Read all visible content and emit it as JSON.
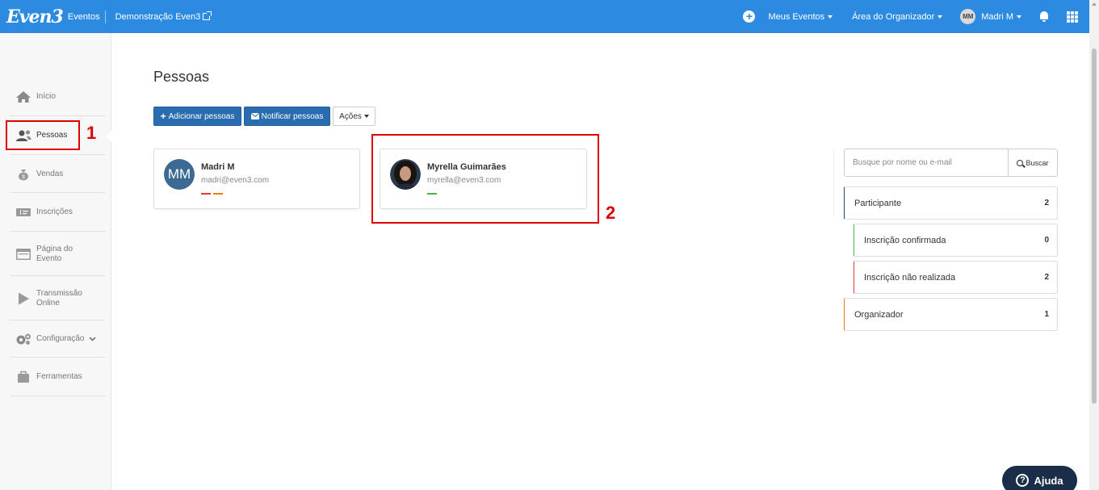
{
  "topbar": {
    "logo": "Even3",
    "events_link": "Eventos",
    "event_name": "Demonstração Even3",
    "my_events": "Meus Eventos",
    "organizer_area": "Área do Organizador",
    "user_initials": "MM",
    "user_name": "Madri M",
    "bg_color": "#2c8be0"
  },
  "sidebar": {
    "items": [
      {
        "label": "Início",
        "icon": "home-icon"
      },
      {
        "label": "Pessoas",
        "icon": "people-icon"
      },
      {
        "label": "Vendas",
        "icon": "money-bag-icon"
      },
      {
        "label": "Inscrições",
        "icon": "ticket-icon"
      },
      {
        "label": "Página do Evento",
        "icon": "browser-icon"
      },
      {
        "label": "Transmissão Online",
        "icon": "play-icon"
      },
      {
        "label": "Configuração",
        "icon": "gears-icon"
      },
      {
        "label": "Ferramentas",
        "icon": "toolbox-icon"
      }
    ]
  },
  "annotations": {
    "one": "1",
    "two": "2"
  },
  "main": {
    "title": "Pessoas",
    "add_button": "Adicionar pessoas",
    "notify_button": "Notificar pessoas",
    "actions_button": "Ações",
    "people": [
      {
        "initials": "MM",
        "name": "Madri M",
        "email": "madri@even3.com",
        "tags": [
          "#e53935",
          "#f57c00"
        ]
      },
      {
        "name": "Myrella Guimarães",
        "email": "myrella@even3.com",
        "tags": [
          "#4caf50"
        ]
      }
    ]
  },
  "filters": {
    "search_placeholder": "Busque por nome ou e-mail",
    "search_button": "Buscar",
    "items": [
      {
        "label": "Participante",
        "count": "2",
        "color": "#1a4a7a"
      },
      {
        "label": "Inscrição confirmada",
        "count": "0",
        "color": "#4caf50"
      },
      {
        "label": "Inscrição não realizada",
        "count": "2",
        "color": "#e53935"
      },
      {
        "label": "Organizador",
        "count": "1",
        "color": "#f57c00"
      }
    ]
  },
  "help": {
    "label": "Ajuda"
  }
}
